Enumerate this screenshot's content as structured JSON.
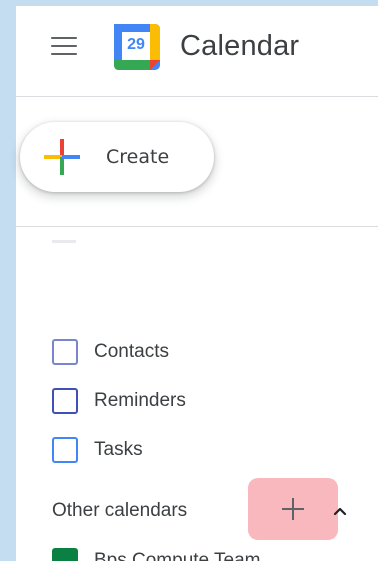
{
  "header": {
    "menu_icon": "hamburger-menu-icon",
    "logo_day": "29",
    "title": "Calendar"
  },
  "create": {
    "label": "Create",
    "icon": "colorful-plus-icon"
  },
  "my_calendars": [
    {
      "label": "Contacts",
      "color": "#7986cb"
    },
    {
      "label": "Reminders",
      "color": "#3f51b5"
    },
    {
      "label": "Tasks",
      "color": "#4285f4"
    }
  ],
  "other_calendars": {
    "label": "Other calendars",
    "add_icon": "plus-icon",
    "collapse_icon": "chevron-up-icon",
    "items": [
      {
        "label": "Bps Compute Team",
        "color": "#0b8043"
      }
    ]
  },
  "colors": {
    "background": "#c5ddf0",
    "panel": "#ffffff",
    "text": "#3c4043",
    "add_highlight": "#f8b8be"
  }
}
